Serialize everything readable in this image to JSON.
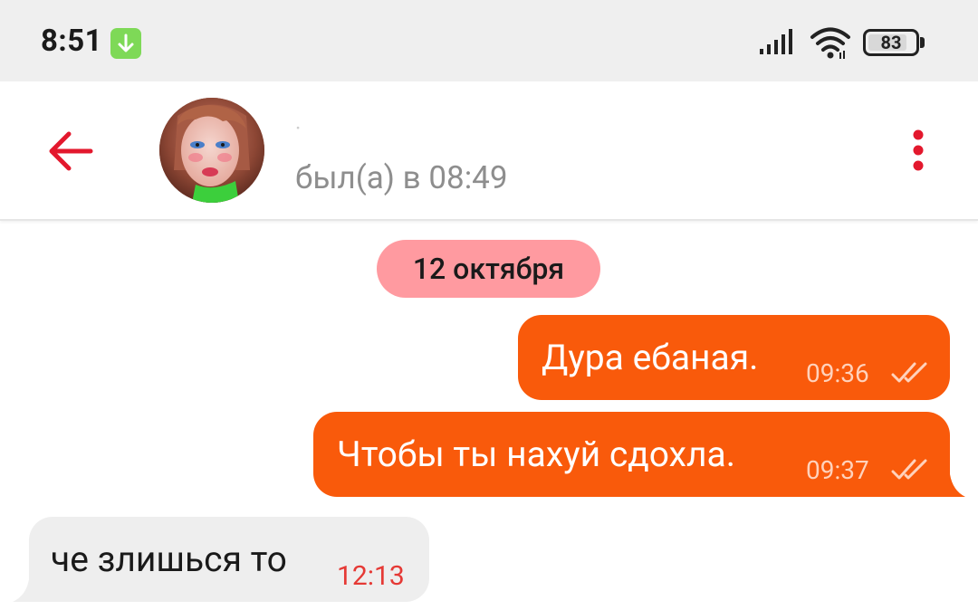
{
  "status_bar": {
    "time": "8:51",
    "battery_level": "83",
    "battery_fraction": 0.83,
    "icons": [
      "download-badge-icon",
      "cell-signal-icon",
      "wifi-icon",
      "battery-icon"
    ]
  },
  "header": {
    "last_seen": "был(а) в 08:49",
    "icons": [
      "back-arrow-icon",
      "more-vert-icon"
    ],
    "accent_color": "#e3182d"
  },
  "chat": {
    "date_chip": "12 октября",
    "messages": [
      {
        "direction": "outgoing",
        "text": "Дура ебаная.",
        "time": "09:36",
        "status": "read"
      },
      {
        "direction": "outgoing",
        "text": "Чтобы ты нахуй сдохла.",
        "time": "09:37",
        "status": "read"
      },
      {
        "direction": "incoming",
        "text": "че злишься то",
        "time": "12:13"
      }
    ]
  },
  "colors": {
    "outgoing_bubble": "#f95a0b",
    "incoming_bubble": "#eeeeee",
    "date_chip": "#ff9aa0",
    "incoming_time": "#e53935"
  }
}
